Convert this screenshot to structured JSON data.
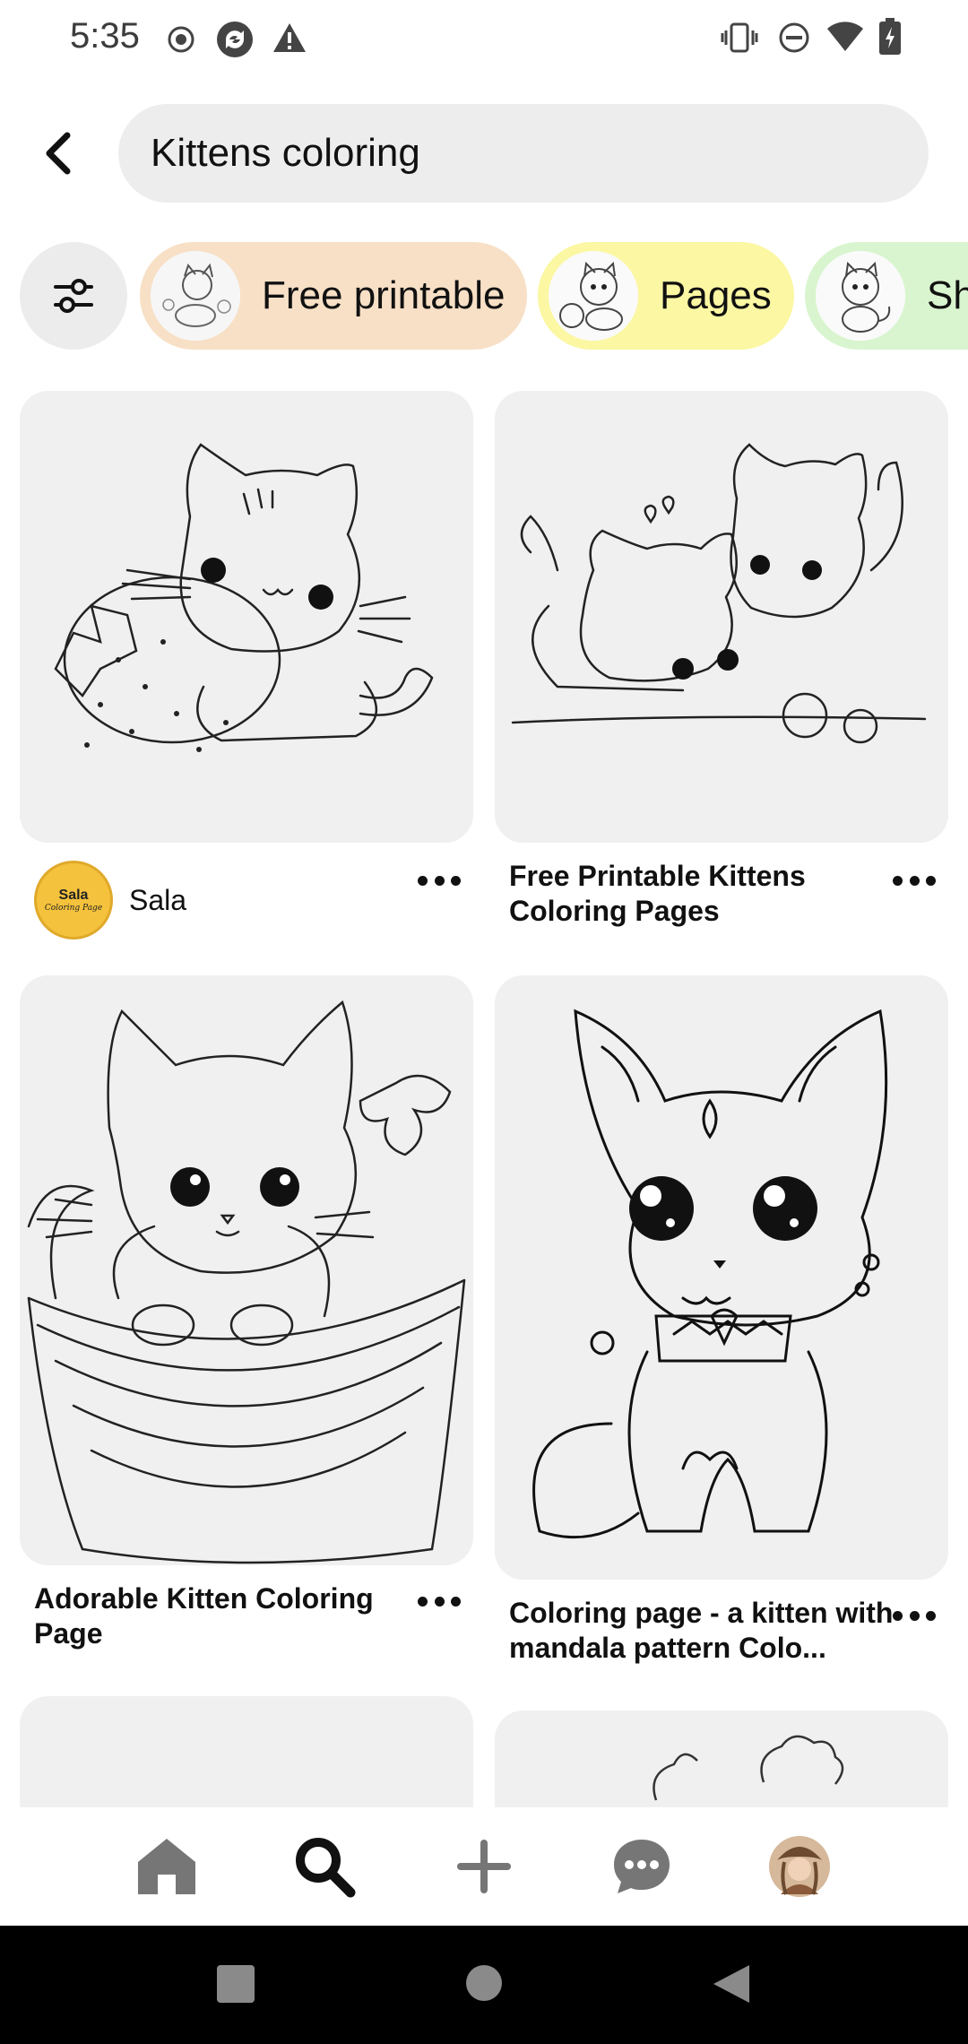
{
  "status_bar": {
    "time": "5:35",
    "left_icons": [
      "record-icon",
      "sync-icon",
      "warning-icon"
    ],
    "right_icons": [
      "vibrate-icon",
      "do-not-disturb-icon",
      "wifi-icon",
      "battery-charging-icon"
    ]
  },
  "search": {
    "query": "Kittens coloring",
    "back_icon": "chevron-left-icon"
  },
  "chips": {
    "filter_icon": "sliders-icon",
    "items": [
      {
        "label": "Free printable",
        "color": "#f7e0c6"
      },
      {
        "label": "Pages",
        "color": "#fbf7a3"
      },
      {
        "label": "Sh",
        "color": "#d9f5cf"
      }
    ]
  },
  "pins": [
    {
      "title": "",
      "author": "Sala",
      "avatar_text": "Sala",
      "avatar_subtext": "Coloring Page"
    },
    {
      "title": "Free Printable Kittens Coloring Pages"
    },
    {
      "title": "Adorable Kitten Coloring Page"
    },
    {
      "title": "Coloring page - a kitten with mandala pattern Colo..."
    }
  ],
  "bottom_nav": {
    "items": [
      "home-icon",
      "search-icon",
      "create-icon",
      "messages-icon",
      "profile-avatar"
    ]
  },
  "system_nav": [
    "recents-button",
    "home-button",
    "back-button"
  ]
}
